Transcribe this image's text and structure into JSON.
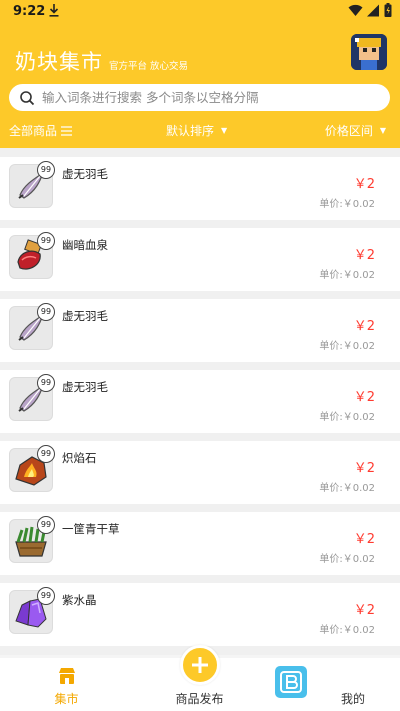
{
  "status_bar": {
    "time": "9:22"
  },
  "header": {
    "title": "奶块集市",
    "subtitle": "官方平台 放心交易"
  },
  "search": {
    "placeholder": "输入词条进行搜索 多个词条以空格分隔"
  },
  "filters": {
    "all_goods": "全部商品",
    "sort": "默认排序",
    "price_range": "价格区间"
  },
  "items": [
    {
      "name": "虚无羽毛",
      "qty": "99",
      "price": "￥2",
      "unit_price": "单价:￥0.02",
      "icon": "feather-icon"
    },
    {
      "name": "幽暗血泉",
      "qty": "99",
      "price": "￥2",
      "unit_price": "单价:￥0.02",
      "icon": "blood-spring-icon"
    },
    {
      "name": "虚无羽毛",
      "qty": "99",
      "price": "￥2",
      "unit_price": "单价:￥0.02",
      "icon": "feather-icon"
    },
    {
      "name": "虚无羽毛",
      "qty": "99",
      "price": "￥2",
      "unit_price": "单价:￥0.02",
      "icon": "feather-icon"
    },
    {
      "name": "炽焰石",
      "qty": "99",
      "price": "￥2",
      "unit_price": "单价:￥0.02",
      "icon": "blaze-stone-icon"
    },
    {
      "name": "一筐青干草",
      "qty": "99",
      "price": "￥2",
      "unit_price": "单价:￥0.02",
      "icon": "hay-basket-icon"
    },
    {
      "name": "紫水晶",
      "qty": "99",
      "price": "￥2",
      "unit_price": "单价:￥0.02",
      "icon": "amethyst-icon"
    }
  ],
  "tabs": {
    "market": "集市",
    "publish": "商品发布",
    "mine": "我的"
  },
  "colors": {
    "accent": "#fdc929",
    "price": "#ff3b30",
    "tab_active": "#f4a800"
  }
}
